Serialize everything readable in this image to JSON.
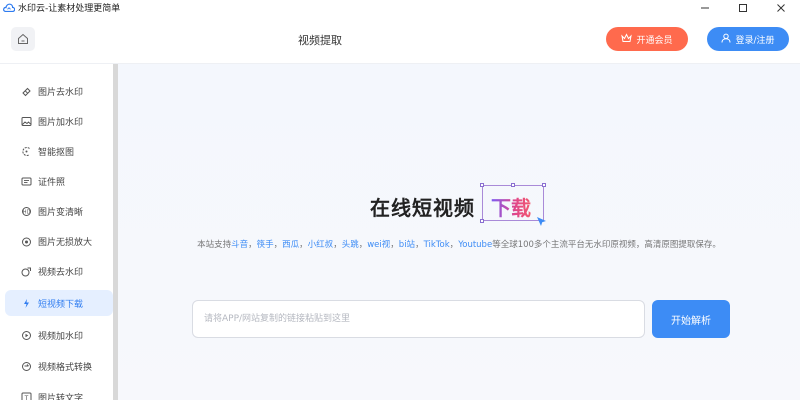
{
  "window": {
    "title": "水印云-让素材处理更简单",
    "controls": [
      "minimize-icon",
      "maximize-icon",
      "close-icon"
    ]
  },
  "header": {
    "page_title": "视频提取",
    "vip_label": "开通会员",
    "login_label": "登录/注册"
  },
  "sidebar": {
    "items": [
      {
        "label": "图片去水印",
        "icon": "eraser-icon",
        "active": false
      },
      {
        "label": "图片加水印",
        "icon": "image-icon",
        "active": false
      },
      {
        "label": "智能抠图",
        "icon": "cutout-icon",
        "active": false
      },
      {
        "label": "证件照",
        "icon": "id-card-icon",
        "active": false
      },
      {
        "label": "图片变清晰",
        "icon": "sharpen-icon",
        "active": false
      },
      {
        "label": "图片无损放大",
        "icon": "enlarge-icon",
        "active": false
      },
      {
        "label": "视频去水印",
        "icon": "video-eraser-icon",
        "active": false
      },
      {
        "label": "短视频下载",
        "icon": "download-icon",
        "active": true
      },
      {
        "label": "视频加水印",
        "icon": "video-watermark-icon",
        "active": false
      },
      {
        "label": "视频格式转换",
        "icon": "convert-icon",
        "active": false
      },
      {
        "label": "图片转文字",
        "icon": "text-icon",
        "active": false
      }
    ]
  },
  "main": {
    "hero_prefix": "在线短视频",
    "hero_accent": "下载",
    "desc": {
      "prefix": "本站支持",
      "platforms": [
        "斗音",
        "筷手",
        "西瓜",
        "小红叔",
        "头跳",
        "wei视",
        "bi站",
        "TikTok",
        "Youtube"
      ],
      "separator": "，",
      "suffix": "等全球100多个主流平台无水印原视频，高清原图提取保存。"
    },
    "input_placeholder": "请将APP/网站复制的链接粘贴到这里",
    "input_value": "",
    "parse_label": "开始解析"
  },
  "colors": {
    "accent_blue": "#3d8cf5",
    "vip_orange": "#ff6a4d",
    "active_bg": "#e5efff"
  }
}
